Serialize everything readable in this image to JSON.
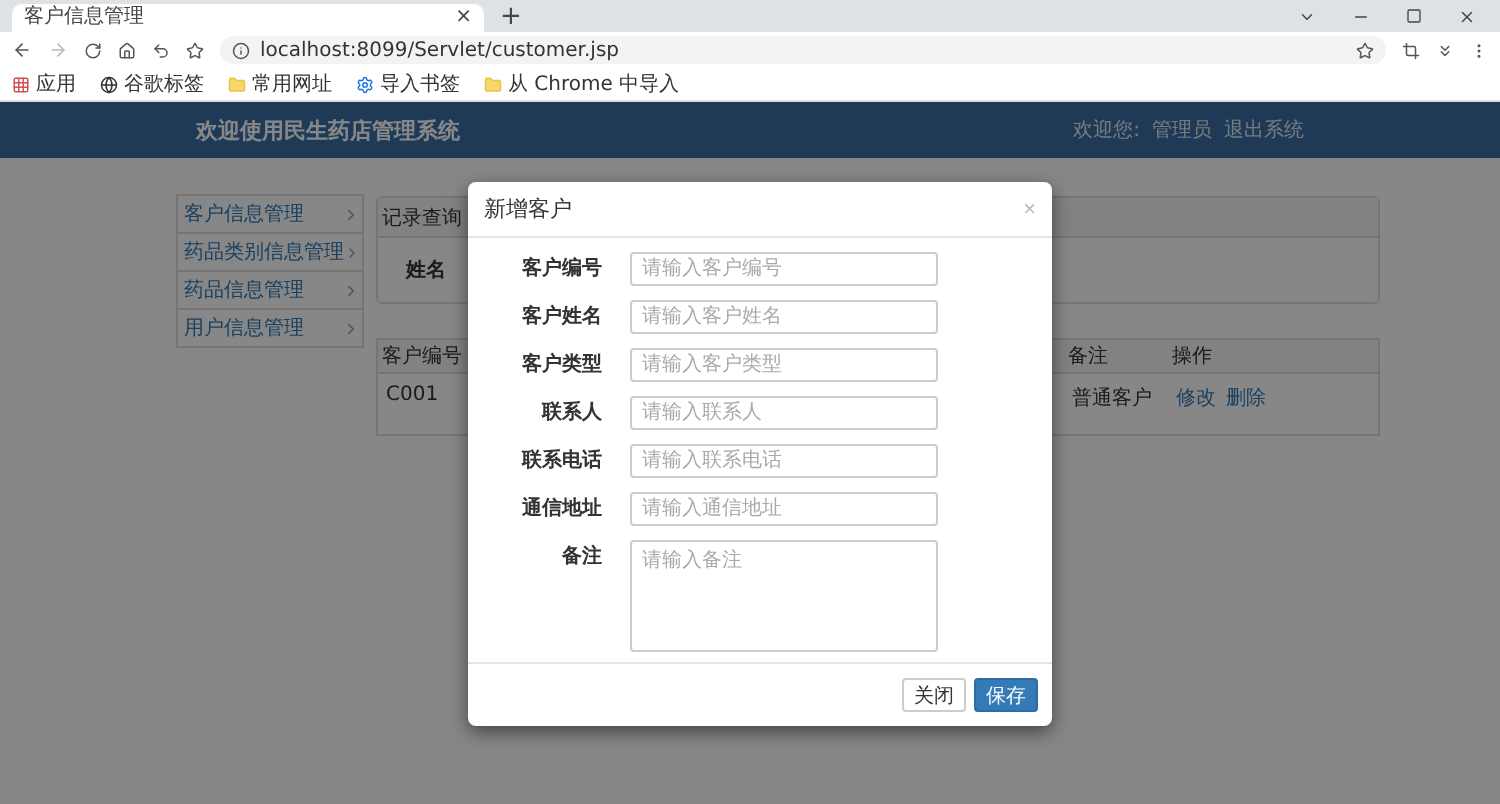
{
  "browser": {
    "tab": {
      "title": "客户信息管理",
      "close": "×"
    },
    "new_tab": "+",
    "url": "localhost:8099/Servlet/customer.jsp",
    "bookmarks": [
      {
        "label": "应用",
        "kind": "apps"
      },
      {
        "label": "谷歌标签",
        "kind": "globe"
      },
      {
        "label": "常用网址",
        "kind": "folder"
      },
      {
        "label": "导入书签",
        "kind": "gear"
      },
      {
        "label": "从 Chrome 中导入",
        "kind": "folder"
      }
    ]
  },
  "header": {
    "title": "欢迎使用民生药店管理系统",
    "welcome": "欢迎您:",
    "user": "管理员",
    "logout": "退出系统"
  },
  "sidebar": {
    "items": [
      {
        "label": "客户信息管理"
      },
      {
        "label": "药品类别信息管理"
      },
      {
        "label": "药品信息管理"
      },
      {
        "label": "用户信息管理"
      }
    ]
  },
  "query": {
    "title": "记录查询",
    "label": "姓名"
  },
  "table": {
    "columns": [
      "客户编号",
      "备注",
      "操作"
    ],
    "rows": [
      {
        "id": "C001",
        "note": "普通客户",
        "actions": [
          "修改",
          "删除"
        ]
      }
    ]
  },
  "modal": {
    "title": "新增客户",
    "close": "×",
    "fields": [
      {
        "label": "客户编号",
        "placeholder": "请输入客户编号",
        "kind": "input"
      },
      {
        "label": "客户姓名",
        "placeholder": "请输入客户姓名",
        "kind": "input"
      },
      {
        "label": "客户类型",
        "placeholder": "请输入客户类型",
        "kind": "input"
      },
      {
        "label": "联系人",
        "placeholder": "请输入联系人",
        "kind": "input"
      },
      {
        "label": "联系电话",
        "placeholder": "请输入联系电话",
        "kind": "input"
      },
      {
        "label": "通信地址",
        "placeholder": "请输入通信地址",
        "kind": "input"
      },
      {
        "label": "备注",
        "placeholder": "请输入备注",
        "kind": "textarea"
      }
    ],
    "buttons": [
      {
        "label": "关闭",
        "kind": "default"
      },
      {
        "label": "保存",
        "kind": "primary"
      }
    ]
  }
}
